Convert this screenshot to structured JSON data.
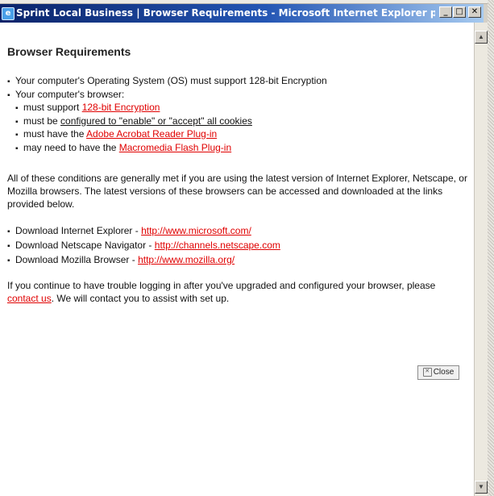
{
  "window": {
    "title": "Sprint Local Business | Browser Requirements - Microsoft Internet Explorer pr...",
    "icon": "ie-page-icon",
    "buttons": {
      "minimize": "_",
      "maximize": "□",
      "close": "✕"
    }
  },
  "page": {
    "heading": "Browser Requirements",
    "requirements": {
      "item1": "Your computer's Operating System (OS) must support 128-bit Encryption",
      "item2": "Your computer's browser:",
      "sub1_prefix": "must support ",
      "sub1_link": "128-bit Encryption",
      "sub2_prefix": "must be ",
      "sub2_underlined": "configured to \"enable\" or \"accept\" all cookies",
      "sub3_prefix": "must have the ",
      "sub3_link": "Adobe Acrobat Reader Plug-in",
      "sub4_prefix": "may need to have the ",
      "sub4_link": "Macromedia Flash Plug-in"
    },
    "paragraph1": "All of these conditions are generally met if you are using the latest version of Internet Explorer, Netscape, or Mozilla browsers. The latest versions of these browsers can be accessed and downloaded at the links provided below.",
    "downloads": [
      {
        "label": "Download Internet Explorer - ",
        "link": "http://www.microsoft.com/"
      },
      {
        "label": "Download Netscape Navigator - ",
        "link": "http://channels.netscape.com"
      },
      {
        "label": "Download Mozilla Browser - ",
        "link": "http://www.mozilla.org/"
      }
    ],
    "paragraph2_prefix": "If you continue to have trouble logging in after you've upgraded and configured your browser, please ",
    "paragraph2_link": "contact us",
    "paragraph2_suffix": ". We will contact you to assist with set up.",
    "close_button": "Close"
  },
  "scrollbar": {
    "up": "▲",
    "down": "▼"
  },
  "colors": {
    "link": "#e00000",
    "titlebar_start": "#0a246a",
    "titlebar_end": "#a6caf0"
  }
}
